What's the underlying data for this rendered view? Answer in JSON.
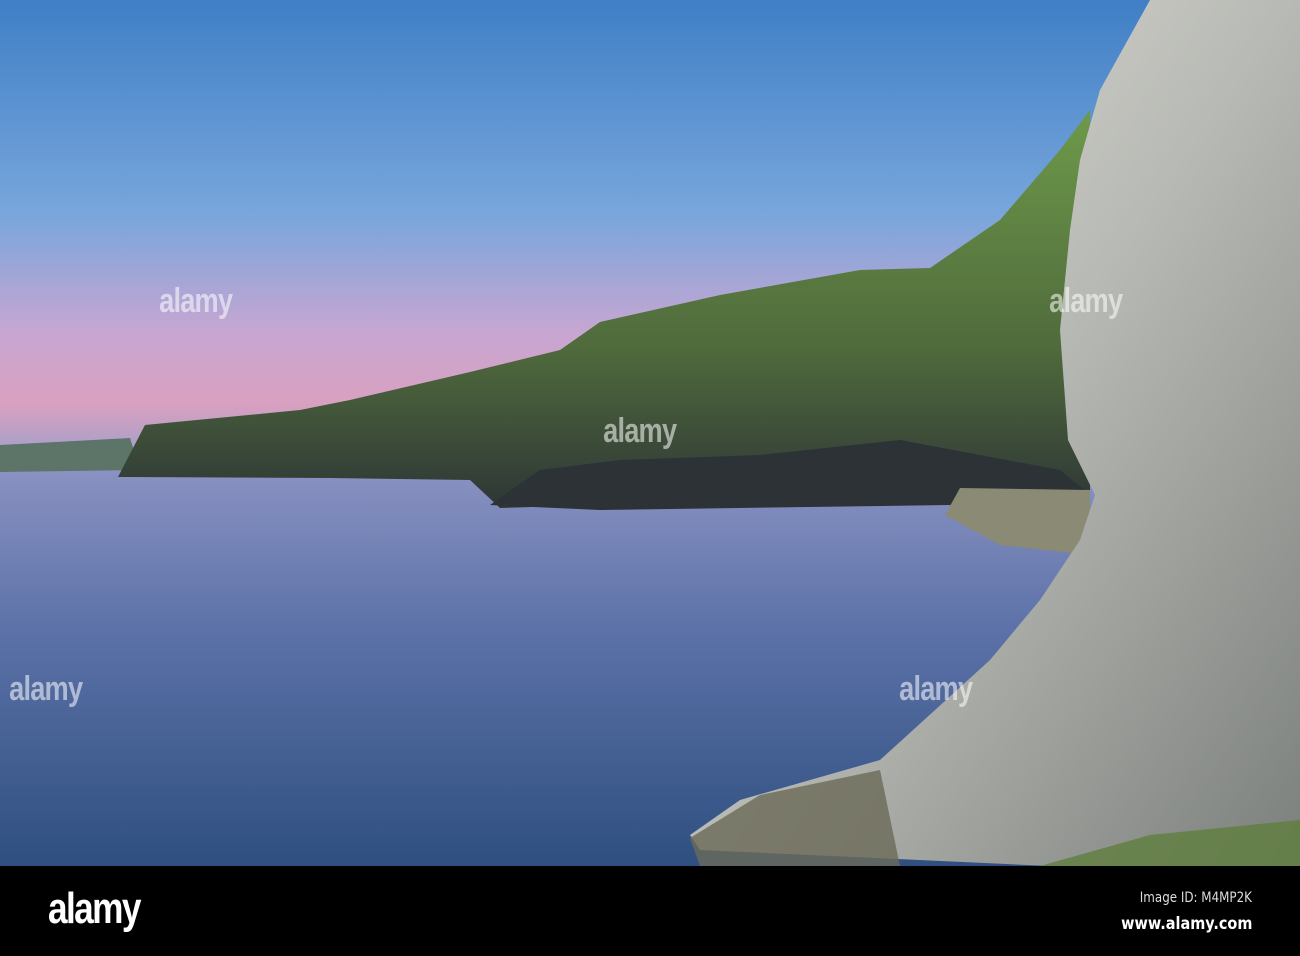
{
  "photo": {
    "subject": "coastal cliffs",
    "colors": {
      "sky_top": "#3f7fc6",
      "sky_horizon": "#d9a0c0",
      "sea_top": "#8190c0",
      "sea_bottom": "#2f4f80",
      "cliff_green": "#5a8a3a",
      "rock_grey": "#9aa0a0"
    }
  },
  "watermark": {
    "text": "alamy"
  },
  "footer": {
    "logo": "alamy",
    "image_id": "Image ID: M4MP2K",
    "website": "www.alamy.com"
  }
}
